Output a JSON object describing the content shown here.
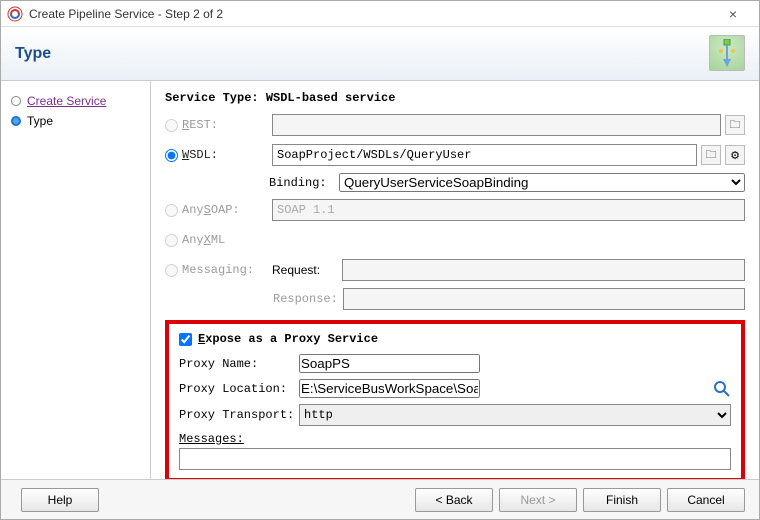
{
  "window": {
    "title": "Create Pipeline Service - Step 2 of 2"
  },
  "banner": {
    "title": "Type"
  },
  "sidebar": {
    "items": [
      {
        "label": "Create Service",
        "active": false
      },
      {
        "label": "Type",
        "active": true
      }
    ]
  },
  "serviceType": {
    "heading": "Service Type: WSDL-based service",
    "rest": {
      "label": "REST:",
      "value": ""
    },
    "wsdl": {
      "label": "WSDL:",
      "value": "SoapProject/WSDLs/QueryUser"
    },
    "binding": {
      "label": "Binding:",
      "value": "QueryUserServiceSoapBinding"
    },
    "anySoap": {
      "label": "Any SOAP:",
      "value": "SOAP 1.1"
    },
    "anyXml": {
      "label": "Any XML"
    },
    "messaging": {
      "label": "Messaging:",
      "request": "Request:",
      "response": "Response:"
    }
  },
  "proxy": {
    "exposeLabel": "Expose as a Proxy Service",
    "nameLabel": "Proxy Name:",
    "nameValue": "SoapPS",
    "locationLabel": "Proxy Location:",
    "locationValue": "E:\\ServiceBusWorkSpace\\SoapApplication\\SoapProject\\ProxyServices",
    "transportLabel": "Proxy Transport:",
    "transportValue": "http",
    "messagesLabel": "Messages:"
  },
  "footer": {
    "help": "Help",
    "back": "< Back",
    "next": "Next >",
    "finish": "Finish",
    "cancel": "Cancel"
  }
}
